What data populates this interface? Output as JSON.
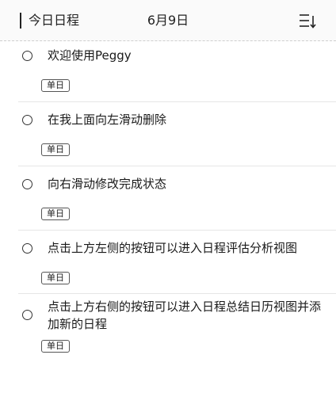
{
  "header": {
    "title": "今日日程",
    "date": "6月9日",
    "menu_icon": "sort-list-icon"
  },
  "items": [
    {
      "text": "欢迎使用Peggy",
      "tag": "单日",
      "done": false
    },
    {
      "text": "在我上面向左滑动删除",
      "tag": "单日",
      "done": false
    },
    {
      "text": "向右滑动修改完成状态",
      "tag": "单日",
      "done": false
    },
    {
      "text": "点击上方左侧的按钮可以进入日程评估分析视图",
      "tag": "单日",
      "done": false
    },
    {
      "text": "点击上方右侧的按钮可以进入日程总结日历视图并添加新的日程",
      "tag": "单日",
      "done": false
    }
  ]
}
